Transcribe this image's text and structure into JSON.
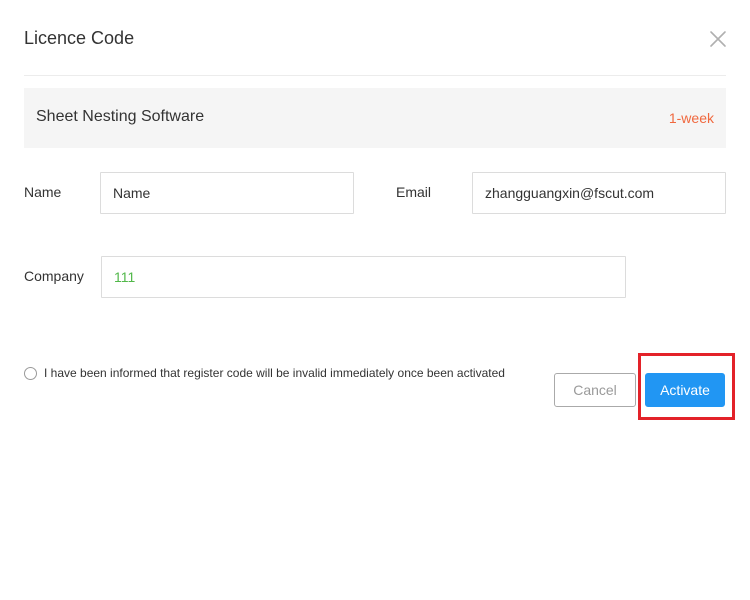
{
  "dialog": {
    "title": "Licence Code",
    "close_icon": "close-icon"
  },
  "product": {
    "name": "Sheet Nesting Software",
    "duration": "1-week",
    "duration_color": "#f0683e"
  },
  "form": {
    "name_label": "Name",
    "name_value": "Name",
    "email_label": "Email",
    "email_value": "zhangguangxin@fscut.com",
    "company_label": "Company",
    "company_value": "111",
    "company_value_color": "#52b84a"
  },
  "consent": {
    "text": "I have been informed that register code will be invalid immediately once been activated",
    "checked": false
  },
  "actions": {
    "cancel_label": "Cancel",
    "activate_label": "Activate",
    "activate_color": "#2196f3",
    "highlight_color": "#e32229"
  }
}
